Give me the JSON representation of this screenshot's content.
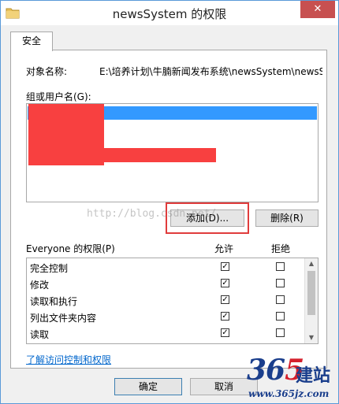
{
  "window": {
    "title": "newsSystem 的权限",
    "close_symbol": "✕"
  },
  "tabs": [
    {
      "label": "安全"
    }
  ],
  "object": {
    "label": "对象名称:",
    "value": "E:\\培养计划\\牛腩新闻发布系统\\newsSystem\\newsSystem"
  },
  "groups": {
    "label": "组或用户名(G):"
  },
  "buttons": {
    "add": "添加(D)...",
    "remove": "删除(R)",
    "ok": "确定",
    "cancel": "取消"
  },
  "permissions": {
    "title": "Everyone 的权限(P)",
    "allow_header": "允许",
    "deny_header": "拒绝",
    "rows": [
      {
        "name": "完全控制",
        "allow": true,
        "deny": false
      },
      {
        "name": "修改",
        "allow": true,
        "deny": false
      },
      {
        "name": "读取和执行",
        "allow": true,
        "deny": false
      },
      {
        "name": "列出文件夹内容",
        "allow": true,
        "deny": false
      },
      {
        "name": "读取",
        "allow": true,
        "deny": false
      }
    ]
  },
  "link": {
    "text": "了解访问控制和权限"
  },
  "watermark": {
    "text": "http://blog.csdn.net/"
  },
  "logo": {
    "number_a": "36",
    "number_b": "5",
    "chinese": "建站",
    "url": "www.365jz.com"
  },
  "colors": {
    "selection": "#3399ff",
    "redaction": "#f84040",
    "highlight": "#e03c3c",
    "link": "#0066cc"
  }
}
